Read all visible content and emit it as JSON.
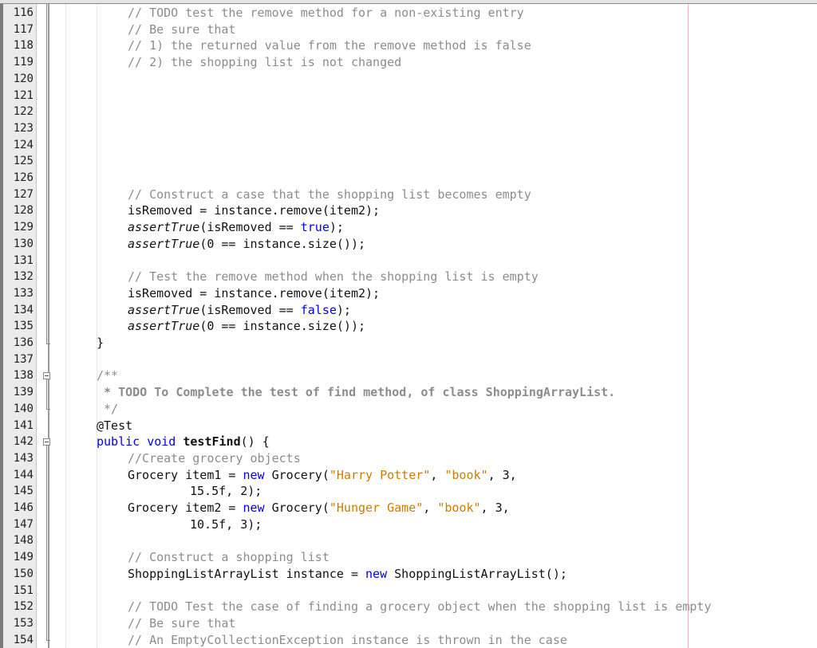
{
  "editor": {
    "language": "java",
    "first_line_number": 116,
    "lines": [
      {
        "n": "116",
        "indent": 2,
        "tokens": [
          {
            "t": "// TODO test the remove method for a non-existing entry",
            "c": "cm"
          }
        ]
      },
      {
        "n": "117",
        "indent": 2,
        "tokens": [
          {
            "t": "// Be sure that",
            "c": "cm"
          }
        ]
      },
      {
        "n": "118",
        "indent": 2,
        "tokens": [
          {
            "t": "// 1) the returned value from the remove method is false",
            "c": "cm"
          }
        ]
      },
      {
        "n": "119",
        "indent": 2,
        "tokens": [
          {
            "t": "// 2) the shopping list is not changed",
            "c": "cm"
          }
        ]
      },
      {
        "n": "120",
        "indent": 0,
        "tokens": []
      },
      {
        "n": "121",
        "indent": 0,
        "tokens": []
      },
      {
        "n": "122",
        "indent": 0,
        "tokens": []
      },
      {
        "n": "123",
        "indent": 0,
        "tokens": []
      },
      {
        "n": "124",
        "indent": 0,
        "tokens": []
      },
      {
        "n": "125",
        "indent": 0,
        "tokens": []
      },
      {
        "n": "126",
        "indent": 0,
        "tokens": []
      },
      {
        "n": "127",
        "indent": 2,
        "tokens": [
          {
            "t": "// Construct a case that the shopping list becomes empty",
            "c": "cm"
          }
        ]
      },
      {
        "n": "128",
        "indent": 2,
        "tokens": [
          {
            "t": "isRemoved = instance.remove(item2);",
            "c": ""
          }
        ]
      },
      {
        "n": "129",
        "indent": 2,
        "tokens": [
          {
            "t": "assertTrue",
            "c": "it"
          },
          {
            "t": "(isRemoved == ",
            "c": ""
          },
          {
            "t": "true",
            "c": "kw"
          },
          {
            "t": ");",
            "c": ""
          }
        ]
      },
      {
        "n": "130",
        "indent": 2,
        "tokens": [
          {
            "t": "assertTrue",
            "c": "it"
          },
          {
            "t": "(0 == instance.size());",
            "c": ""
          }
        ]
      },
      {
        "n": "131",
        "indent": 0,
        "tokens": []
      },
      {
        "n": "132",
        "indent": 2,
        "tokens": [
          {
            "t": "// Test the remove method when the shopping list is empty",
            "c": "cm"
          }
        ]
      },
      {
        "n": "133",
        "indent": 2,
        "tokens": [
          {
            "t": "isRemoved = instance.remove(item2);",
            "c": ""
          }
        ]
      },
      {
        "n": "134",
        "indent": 2,
        "tokens": [
          {
            "t": "assertTrue",
            "c": "it"
          },
          {
            "t": "(isRemoved == ",
            "c": ""
          },
          {
            "t": "false",
            "c": "kw"
          },
          {
            "t": ");",
            "c": ""
          }
        ]
      },
      {
        "n": "135",
        "indent": 2,
        "tokens": [
          {
            "t": "assertTrue",
            "c": "it"
          },
          {
            "t": "(0 == instance.size());",
            "c": ""
          }
        ]
      },
      {
        "n": "136",
        "indent": 1,
        "tokens": [
          {
            "t": "}",
            "c": ""
          }
        ]
      },
      {
        "n": "137",
        "indent": 0,
        "tokens": []
      },
      {
        "n": "138",
        "indent": 1,
        "tokens": [
          {
            "t": "/**",
            "c": "cm"
          }
        ]
      },
      {
        "n": "139",
        "indent": 1,
        "tokens": [
          {
            "t": " * TODO To Complete the test of find method, of class ShoppingArrayList.",
            "c": "jd"
          }
        ]
      },
      {
        "n": "140",
        "indent": 1,
        "tokens": [
          {
            "t": " */",
            "c": "cm"
          }
        ]
      },
      {
        "n": "141",
        "indent": 1,
        "tokens": [
          {
            "t": "@Test",
            "c": ""
          }
        ]
      },
      {
        "n": "142",
        "indent": 1,
        "tokens": [
          {
            "t": "public void ",
            "c": "kw"
          },
          {
            "t": "testFind",
            "c": "b"
          },
          {
            "t": "() {",
            "c": ""
          }
        ]
      },
      {
        "n": "143",
        "indent": 2,
        "tokens": [
          {
            "t": "//Create grocery objects",
            "c": "cm"
          }
        ]
      },
      {
        "n": "144",
        "indent": 2,
        "tokens": [
          {
            "t": "Grocery item1 = ",
            "c": ""
          },
          {
            "t": "new",
            "c": "kw"
          },
          {
            "t": " Grocery(",
            "c": ""
          },
          {
            "t": "\"Harry Potter\"",
            "c": "str"
          },
          {
            "t": ", ",
            "c": ""
          },
          {
            "t": "\"book\"",
            "c": "str"
          },
          {
            "t": ", 3,",
            "c": ""
          }
        ]
      },
      {
        "n": "145",
        "indent": 4,
        "tokens": [
          {
            "t": "15.5f, 2);",
            "c": ""
          }
        ]
      },
      {
        "n": "146",
        "indent": 2,
        "tokens": [
          {
            "t": "Grocery item2 = ",
            "c": ""
          },
          {
            "t": "new",
            "c": "kw"
          },
          {
            "t": " Grocery(",
            "c": ""
          },
          {
            "t": "\"Hunger Game\"",
            "c": "str"
          },
          {
            "t": ", ",
            "c": ""
          },
          {
            "t": "\"book\"",
            "c": "str"
          },
          {
            "t": ", 3,",
            "c": ""
          }
        ]
      },
      {
        "n": "147",
        "indent": 4,
        "tokens": [
          {
            "t": "10.5f, 3);",
            "c": ""
          }
        ]
      },
      {
        "n": "148",
        "indent": 0,
        "tokens": []
      },
      {
        "n": "149",
        "indent": 2,
        "tokens": [
          {
            "t": "// Construct a shopping list",
            "c": "cm"
          }
        ]
      },
      {
        "n": "150",
        "indent": 2,
        "tokens": [
          {
            "t": "ShoppingListArrayList instance = ",
            "c": ""
          },
          {
            "t": "new",
            "c": "kw"
          },
          {
            "t": " ShoppingListArrayList();",
            "c": ""
          }
        ]
      },
      {
        "n": "151",
        "indent": 0,
        "tokens": []
      },
      {
        "n": "152",
        "indent": 2,
        "tokens": [
          {
            "t": "// TODO Test the case of finding a grocery object when the shopping list is empty",
            "c": "cm"
          }
        ]
      },
      {
        "n": "153",
        "indent": 2,
        "tokens": [
          {
            "t": "// Be sure that",
            "c": "cm"
          }
        ]
      },
      {
        "n": "154",
        "indent": 2,
        "tokens": [
          {
            "t": "// An EmptyCollectionException instance is thrown in the case",
            "c": "cm"
          }
        ]
      }
    ],
    "folds": [
      {
        "start_line": "138",
        "end_line": "140",
        "icon": "collapse-icon"
      },
      {
        "start_line": "142",
        "end_line": "154",
        "icon": "collapse-icon"
      }
    ],
    "colors": {
      "keyword": "#0000e6",
      "string": "#ce7b00",
      "comment": "#8c8c8c",
      "text": "#111111",
      "right_margin": "#f5b8b8"
    }
  }
}
